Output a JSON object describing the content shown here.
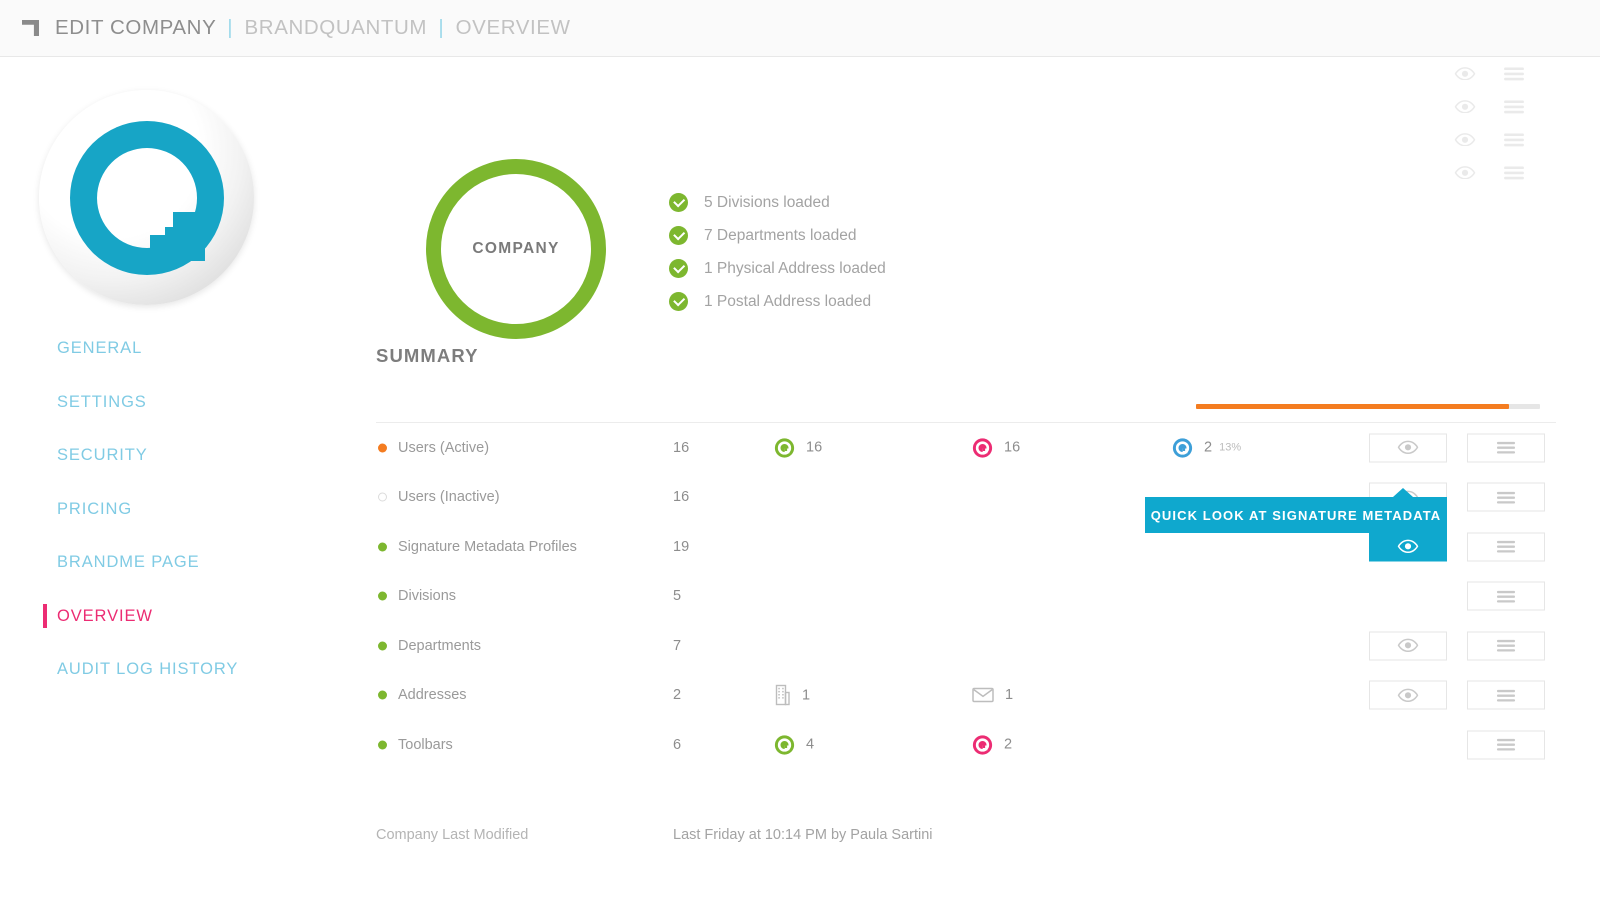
{
  "header": {
    "corner_icon": "corner-bracket-icon",
    "breadcrumb_primary": "EDIT COMPANY",
    "separator": "|",
    "breadcrumb_secondary": "BRANDQUANTUM",
    "breadcrumb_tertiary": "OVERVIEW"
  },
  "hero": {
    "logo_alt": "brandquantum-q-logo",
    "company_ring_label": "COMPANY",
    "checklist": [
      {
        "text": "5 Divisions loaded",
        "eye_icon": "eye-icon",
        "menu_icon": "hamburger-icon"
      },
      {
        "text": "7 Departments loaded",
        "eye_icon": "eye-icon",
        "menu_icon": "hamburger-icon"
      },
      {
        "text": "1 Physical Address loaded",
        "eye_icon": "eye-icon",
        "menu_icon": "hamburger-icon"
      },
      {
        "text": "1 Postal Address loaded",
        "eye_icon": "eye-icon",
        "menu_icon": "hamburger-icon"
      }
    ]
  },
  "sidebar": {
    "items": [
      {
        "label": "GENERAL",
        "active": false
      },
      {
        "label": "SETTINGS",
        "active": false
      },
      {
        "label": "SECURITY",
        "active": false
      },
      {
        "label": "PRICING",
        "active": false
      },
      {
        "label": "BRANDME PAGE",
        "active": false
      },
      {
        "label": "OVERVIEW",
        "active": true
      },
      {
        "label": "AUDIT LOG HISTORY",
        "active": false
      }
    ]
  },
  "main": {
    "title": "SUMMARY",
    "progress_percent": 91,
    "rows": [
      {
        "label": "Users (Active)",
        "dot": "orange",
        "count": "16",
        "metrics": [
          {
            "icon": "q-badge-green-icon",
            "color": "#7db72f",
            "value": "16",
            "pct": ""
          },
          {
            "icon": "q-badge-pink-icon",
            "color": "#ec2c73",
            "value": "16",
            "pct": ""
          },
          {
            "icon": "q-badge-blue-icon",
            "color": "#3d9fd8",
            "value": "2",
            "pct": "13%"
          }
        ],
        "has_eye": true,
        "has_menu": true,
        "eye_active": false
      },
      {
        "label": "Users (Inactive)",
        "dot": "hollow",
        "count": "16",
        "metrics": [],
        "has_eye": true,
        "has_menu": true,
        "eye_active": false
      },
      {
        "label": "Signature Metadata Profiles",
        "dot": "green",
        "count": "19",
        "metrics": [],
        "has_eye": true,
        "has_menu": true,
        "eye_active": true
      },
      {
        "label": "Divisions",
        "dot": "green",
        "count": "5",
        "metrics": [],
        "has_eye": false,
        "has_menu": true,
        "eye_active": false
      },
      {
        "label": "Departments",
        "dot": "green",
        "count": "7",
        "metrics": [],
        "has_eye": true,
        "has_menu": true,
        "eye_active": false
      },
      {
        "label": "Addresses",
        "dot": "green",
        "count": "2",
        "metrics": [
          {
            "icon": "building-icon",
            "color": "#bdbdbd",
            "value": "1",
            "pct": ""
          },
          {
            "icon": "envelope-icon",
            "color": "#bdbdbd",
            "value": "1",
            "pct": ""
          }
        ],
        "has_eye": true,
        "has_menu": true,
        "eye_active": false
      },
      {
        "label": "Toolbars",
        "dot": "green",
        "count": "6",
        "metrics": [
          {
            "icon": "q-badge-green-icon",
            "color": "#7db72f",
            "value": "4",
            "pct": ""
          },
          {
            "icon": "q-badge-pink-icon",
            "color": "#ec2c73",
            "value": "2",
            "pct": ""
          }
        ],
        "has_eye": false,
        "has_menu": true,
        "eye_active": false
      }
    ],
    "tooltip": "QUICK LOOK AT SIGNATURE METADATA",
    "footer_label": "Company Last Modified",
    "footer_value": "Last Friday at 10:14 PM by Paula Sartini"
  },
  "colors": {
    "brand_cyan": "#0fa8ce",
    "green": "#7db72f",
    "pink": "#ec2c73",
    "orange": "#f47c20",
    "blue": "#3d9fd8",
    "nav_blue": "#80cbe4"
  }
}
